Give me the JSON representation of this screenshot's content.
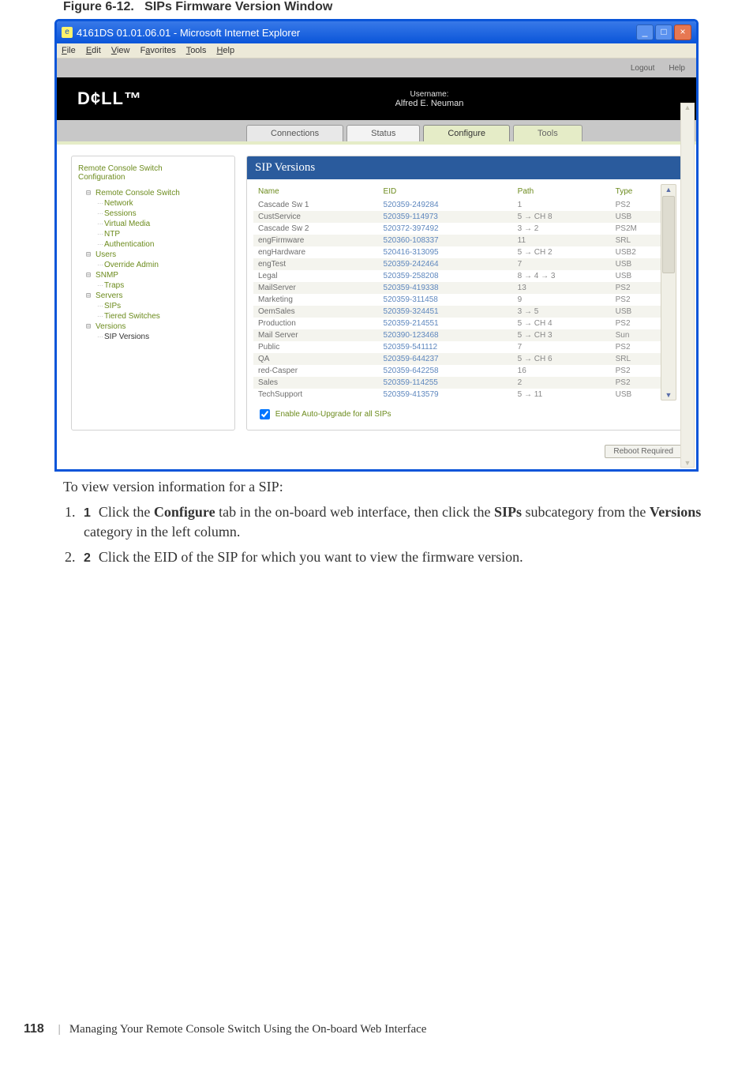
{
  "figure": {
    "label": "Figure 6-12.",
    "title": "SIPs Firmware Version Window"
  },
  "caption": "To view version information for a SIP:",
  "steps": [
    {
      "n": "1",
      "pre": "Click the ",
      "b1": "Configure",
      "mid1": " tab in the on-board web interface, then click the ",
      "b2": "SIPs",
      "mid2": " subcategory from the ",
      "b3": "Versions",
      "post": " category in the left column."
    },
    {
      "n": "2",
      "pre": "Click the EID of the SIP for which you want to view the firmware version.",
      "b1": "",
      "mid1": "",
      "b2": "",
      "mid2": "",
      "b3": "",
      "post": ""
    }
  ],
  "footer": {
    "page": "118",
    "chapter": "Managing Your Remote Console Switch Using the On-board Web Interface"
  },
  "ie": {
    "title": "4161DS 01.01.06.01 - Microsoft Internet Explorer",
    "menus": [
      "File",
      "Edit",
      "View",
      "Favorites",
      "Tools",
      "Help"
    ]
  },
  "topbar": {
    "logout": "Logout",
    "help": "Help"
  },
  "header": {
    "logo": "D¢LL™",
    "user_label": "Username:",
    "user_name": "Alfred E. Neuman"
  },
  "tabs": {
    "connections": "Connections",
    "status": "Status",
    "configure": "Configure",
    "tools": "Tools"
  },
  "tree": {
    "title1": "Remote Console Switch",
    "title2": "Configuration",
    "items": [
      {
        "t": "Remote Console Switch",
        "cls": "node"
      },
      {
        "t": "Network",
        "cls": "leaf",
        "ind": 1
      },
      {
        "t": "Sessions",
        "cls": "leaf",
        "ind": 1
      },
      {
        "t": "Virtual Media",
        "cls": "leaf",
        "ind": 1
      },
      {
        "t": "NTP",
        "cls": "leaf",
        "ind": 1
      },
      {
        "t": "Authentication",
        "cls": "leaf",
        "ind": 1
      },
      {
        "t": "Users",
        "cls": "node"
      },
      {
        "t": "Override Admin",
        "cls": "leaf",
        "ind": 1
      },
      {
        "t": "SNMP",
        "cls": "node"
      },
      {
        "t": "Traps",
        "cls": "leaf",
        "ind": 1
      },
      {
        "t": "Servers",
        "cls": "node"
      },
      {
        "t": "SIPs",
        "cls": "leaf",
        "ind": 1
      },
      {
        "t": "Tiered Switches",
        "cls": "leaf",
        "ind": 1
      },
      {
        "t": "Versions",
        "cls": "node"
      },
      {
        "t": "SIP Versions",
        "cls": "leaf active",
        "ind": 1
      }
    ]
  },
  "panel": {
    "title": "SIP Versions",
    "headers": {
      "name": "Name",
      "eid": "EID",
      "path": "Path",
      "type": "Type"
    },
    "rows": [
      {
        "name": "Cascade Sw 1",
        "eid": "520359-249284",
        "path": "1",
        "type": "PS2"
      },
      {
        "name": "CustService",
        "eid": "520359-114973",
        "path": "5 → CH 8",
        "type": "USB"
      },
      {
        "name": "Cascade Sw 2",
        "eid": "520372-397492",
        "path": "3 → 2",
        "type": "PS2M"
      },
      {
        "name": "engFirmware",
        "eid": "520360-108337",
        "path": "11",
        "type": "SRL"
      },
      {
        "name": "engHardware",
        "eid": "520416-313095",
        "path": "5 → CH 2",
        "type": "USB2"
      },
      {
        "name": "engTest",
        "eid": "520359-242464",
        "path": "7",
        "type": "USB"
      },
      {
        "name": "Legal",
        "eid": "520359-258208",
        "path": "8 → 4 → 3",
        "type": "USB"
      },
      {
        "name": "MailServer",
        "eid": "520359-419338",
        "path": "13",
        "type": "PS2"
      },
      {
        "name": "Marketing",
        "eid": "520359-311458",
        "path": "9",
        "type": "PS2"
      },
      {
        "name": "OemSales",
        "eid": "520359-324451",
        "path": "3 → 5",
        "type": "USB"
      },
      {
        "name": "Production",
        "eid": "520359-214551",
        "path": "5 → CH 4",
        "type": "PS2"
      },
      {
        "name": "Mail Server",
        "eid": "520390-123468",
        "path": "5 → CH 3",
        "type": "Sun"
      },
      {
        "name": "Public",
        "eid": "520359-541112",
        "path": "7",
        "type": "PS2"
      },
      {
        "name": "QA",
        "eid": "520359-644237",
        "path": "5 → CH 6",
        "type": "SRL"
      },
      {
        "name": "red-Casper",
        "eid": "520359-642258",
        "path": "16",
        "type": "PS2"
      },
      {
        "name": "Sales",
        "eid": "520359-114255",
        "path": "2",
        "type": "PS2"
      },
      {
        "name": "TechSupport",
        "eid": "520359-413579",
        "path": "5 → 11",
        "type": "USB"
      }
    ],
    "checkbox": "Enable Auto-Upgrade for all SIPs",
    "reboot": "Reboot Required"
  }
}
